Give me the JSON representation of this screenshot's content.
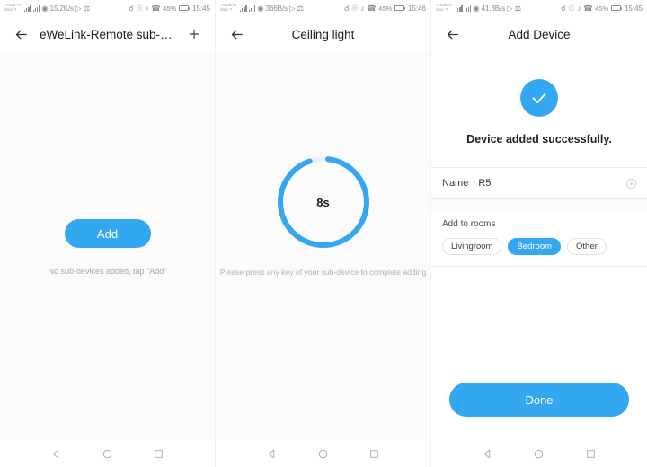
{
  "screens": [
    {
      "statusbar": {
        "carrier_line1": "TRUE-H",
        "carrier_line2": "dtac-T",
        "data_rate": "15.2K/s",
        "battery_pct": "45%",
        "clock": "15:45",
        "icons": [
          "signal-bars-icon",
          "signal-bars-icon",
          "wifi-icon",
          "play-icon",
          "bluetooth-icon",
          "key-icon",
          "eye-icon",
          "mute-icon",
          "phone-icon",
          "battery-icon"
        ]
      },
      "appbar": {
        "back_label": "←",
        "title": "eWeLink-Remote sub-d…",
        "action_label": "+"
      },
      "body": {
        "add_button": "Add",
        "hint": "No sub-devices added, tap \"Add\""
      }
    },
    {
      "statusbar": {
        "carrier_line1": "TRUE-H",
        "carrier_line2": "dtac-T",
        "data_rate": "366B/s",
        "battery_pct": "45%",
        "clock": "15:46",
        "icons": [
          "signal-bars-icon",
          "signal-bars-icon",
          "wifi-icon",
          "play-icon",
          "bluetooth-icon",
          "key-icon",
          "eye-icon",
          "mute-icon",
          "phone-icon",
          "battery-icon"
        ]
      },
      "appbar": {
        "back_label": "←",
        "title": "Ceiling light"
      },
      "body": {
        "countdown": "8s",
        "progress_percent": 93,
        "hint": "Please press any key of your sub-device to complete adding"
      }
    },
    {
      "statusbar": {
        "carrier_line1": "TRUE-H",
        "carrier_line2": "dtac-T",
        "data_rate": "41.3B/s",
        "battery_pct": "45%",
        "clock": "15:45",
        "icons": [
          "signal-bars-icon",
          "signal-bars-icon",
          "wifi-icon",
          "play-icon",
          "bluetooth-icon",
          "key-icon",
          "eye-icon",
          "mute-icon",
          "phone-icon",
          "battery-icon"
        ]
      },
      "appbar": {
        "back_label": "←",
        "title": "Add Device"
      },
      "body": {
        "success_message": "Device added successfully.",
        "name_label": "Name",
        "name_value": "R5",
        "name_placeholder": "Name",
        "rooms_label": "Add to rooms",
        "rooms": [
          {
            "label": "Livingroom",
            "selected": false
          },
          {
            "label": "Bedroom",
            "selected": true
          },
          {
            "label": "Other",
            "selected": false
          }
        ],
        "done_button": "Done"
      }
    }
  ],
  "navbar": {
    "back": "back-triangle-icon",
    "home": "home-circle-icon",
    "recents": "recents-square-icon"
  },
  "colors": {
    "accent": "#33a8f0",
    "page_bg": "#fbfbfb",
    "card_bg": "#ffffff",
    "divider": "#ececec",
    "muted_text": "#a6a6a6"
  }
}
